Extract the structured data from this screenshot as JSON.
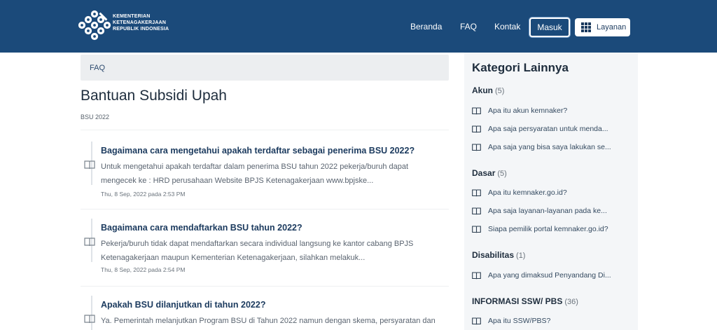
{
  "header": {
    "logo_lines": [
      "KEMENTERIAN",
      "KETENAGAKERJAAN",
      "REPUBLIK INDONESIA"
    ],
    "nav": [
      "Beranda",
      "FAQ",
      "Kontak"
    ],
    "login_label": "Masuk",
    "services_label": "Layanan",
    "colors": {
      "bar": "#1b4a7a",
      "text": "#ffffff"
    }
  },
  "breadcrumb": "FAQ",
  "page": {
    "title": "Bantuan Subsidi Upah",
    "subtitle": "BSU 2022"
  },
  "articles": [
    {
      "title": "Bagaimana cara mengetahui apakah terdaftar sebagai penerima BSU 2022?",
      "excerpt_1": "Untuk mengetahui apakah terdaftar dalam penerima BSU tahun 2022 pekerja/buruh dapat",
      "excerpt_2": "mengecek ke : HRD perusahaan Website BPJS Ketenagakerjaan www.bpjske...",
      "date": "Thu, 8 Sep, 2022 pada 2:53 PM",
      "icon": "book-icon"
    },
    {
      "title": "Bagaimana cara mendaftarkan BSU tahun 2022?",
      "excerpt_1": "Pekerja/buruh tidak dapat mendaftarkan secara individual langsung ke kantor cabang BPJS",
      "excerpt_2": "Ketenagakerjaan maupun Kementerian Ketenagakerjaan, silahkan melakuk...",
      "date": "Thu, 8 Sep, 2022 pada 2:54 PM",
      "icon": "book-icon"
    },
    {
      "title": "Apakah BSU dilanjutkan di tahun 2022?",
      "excerpt_1": "Ya. Pemerintah melanjutkan Program BSU di Tahun 2022 namun dengan skema, persyaratan dan",
      "excerpt_2": "",
      "date": "",
      "icon": "book-icon"
    }
  ],
  "sidebar": {
    "heading": "Kategori Lainnya",
    "categories": [
      {
        "name": "Akun",
        "count": "(5)",
        "links": [
          "Apa itu akun kemnaker?",
          "Apa saja persyaratan untuk menda...",
          "Apa saja yang bisa saya lakukan se..."
        ]
      },
      {
        "name": "Dasar",
        "count": "(5)",
        "links": [
          "Apa itu kemnaker.go.id?",
          "Apa saja layanan-layanan pada ke...",
          "Siapa pemilik portal kemnaker.go.id?"
        ]
      },
      {
        "name": "Disabilitas",
        "count": "(1)",
        "links": [
          "Apa yang dimaksud Penyandang Di..."
        ]
      },
      {
        "name": "INFORMASI SSW/ PBS",
        "count": "(36)",
        "links": [
          "Apa itu SSW/PBS?"
        ]
      }
    ]
  }
}
